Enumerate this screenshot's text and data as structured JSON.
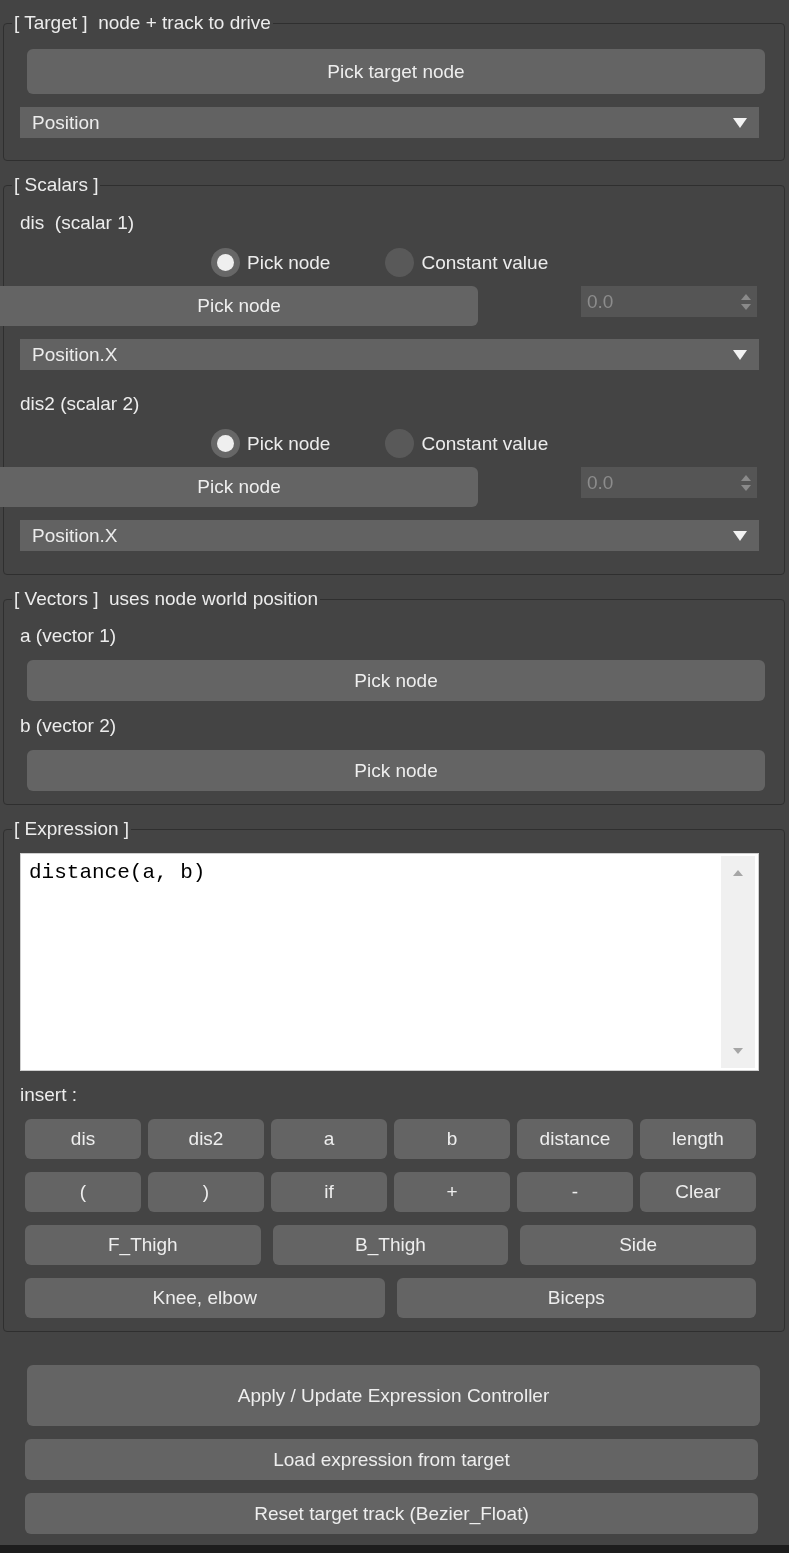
{
  "target": {
    "title": "[ Target ]  node + track to drive",
    "pick_button": "Pick target node",
    "track_dropdown": {
      "value": "Position"
    }
  },
  "scalars": {
    "title": "[ Scalars ]",
    "items": [
      {
        "label": "dis  (scalar 1)",
        "source_options": [
          {
            "label": "Pick node",
            "selected": true
          },
          {
            "label": "Constant value",
            "selected": false
          }
        ],
        "pick_button": "Pick node",
        "constant_field": {
          "value": "0.0",
          "disabled": true
        },
        "track_dropdown": {
          "value": "Position.X"
        }
      },
      {
        "label": "dis2 (scalar 2)",
        "source_options": [
          {
            "label": "Pick node",
            "selected": true
          },
          {
            "label": "Constant value",
            "selected": false
          }
        ],
        "pick_button": "Pick node",
        "constant_field": {
          "value": "0.0",
          "disabled": true
        },
        "track_dropdown": {
          "value": "Position.X"
        }
      }
    ]
  },
  "vectors": {
    "title": "[ Vectors ]  uses node world position",
    "items": [
      {
        "label": "a (vector 1)",
        "pick_button": "Pick node"
      },
      {
        "label": "b (vector 2)",
        "pick_button": "Pick node"
      }
    ]
  },
  "expression": {
    "title": "[ Expression ]",
    "editor": {
      "value": "distance(a, b)"
    },
    "insert_label": "insert :",
    "insert_rows": [
      [
        "dis",
        "dis2",
        "a",
        "b",
        "distance",
        "length"
      ],
      [
        "(",
        ")",
        "if",
        "+",
        "-",
        "Clear"
      ],
      [
        "F_Thigh",
        "B_Thigh",
        "Side"
      ],
      [
        "Knee, elbow",
        "Biceps"
      ]
    ]
  },
  "actions": [
    {
      "label": "Apply / Update Expression Controller",
      "kind": "primary"
    },
    {
      "label": "Load expression from target",
      "kind": "secondary"
    },
    {
      "label": "Reset target track (Bezier_Float)",
      "kind": "secondary"
    }
  ]
}
